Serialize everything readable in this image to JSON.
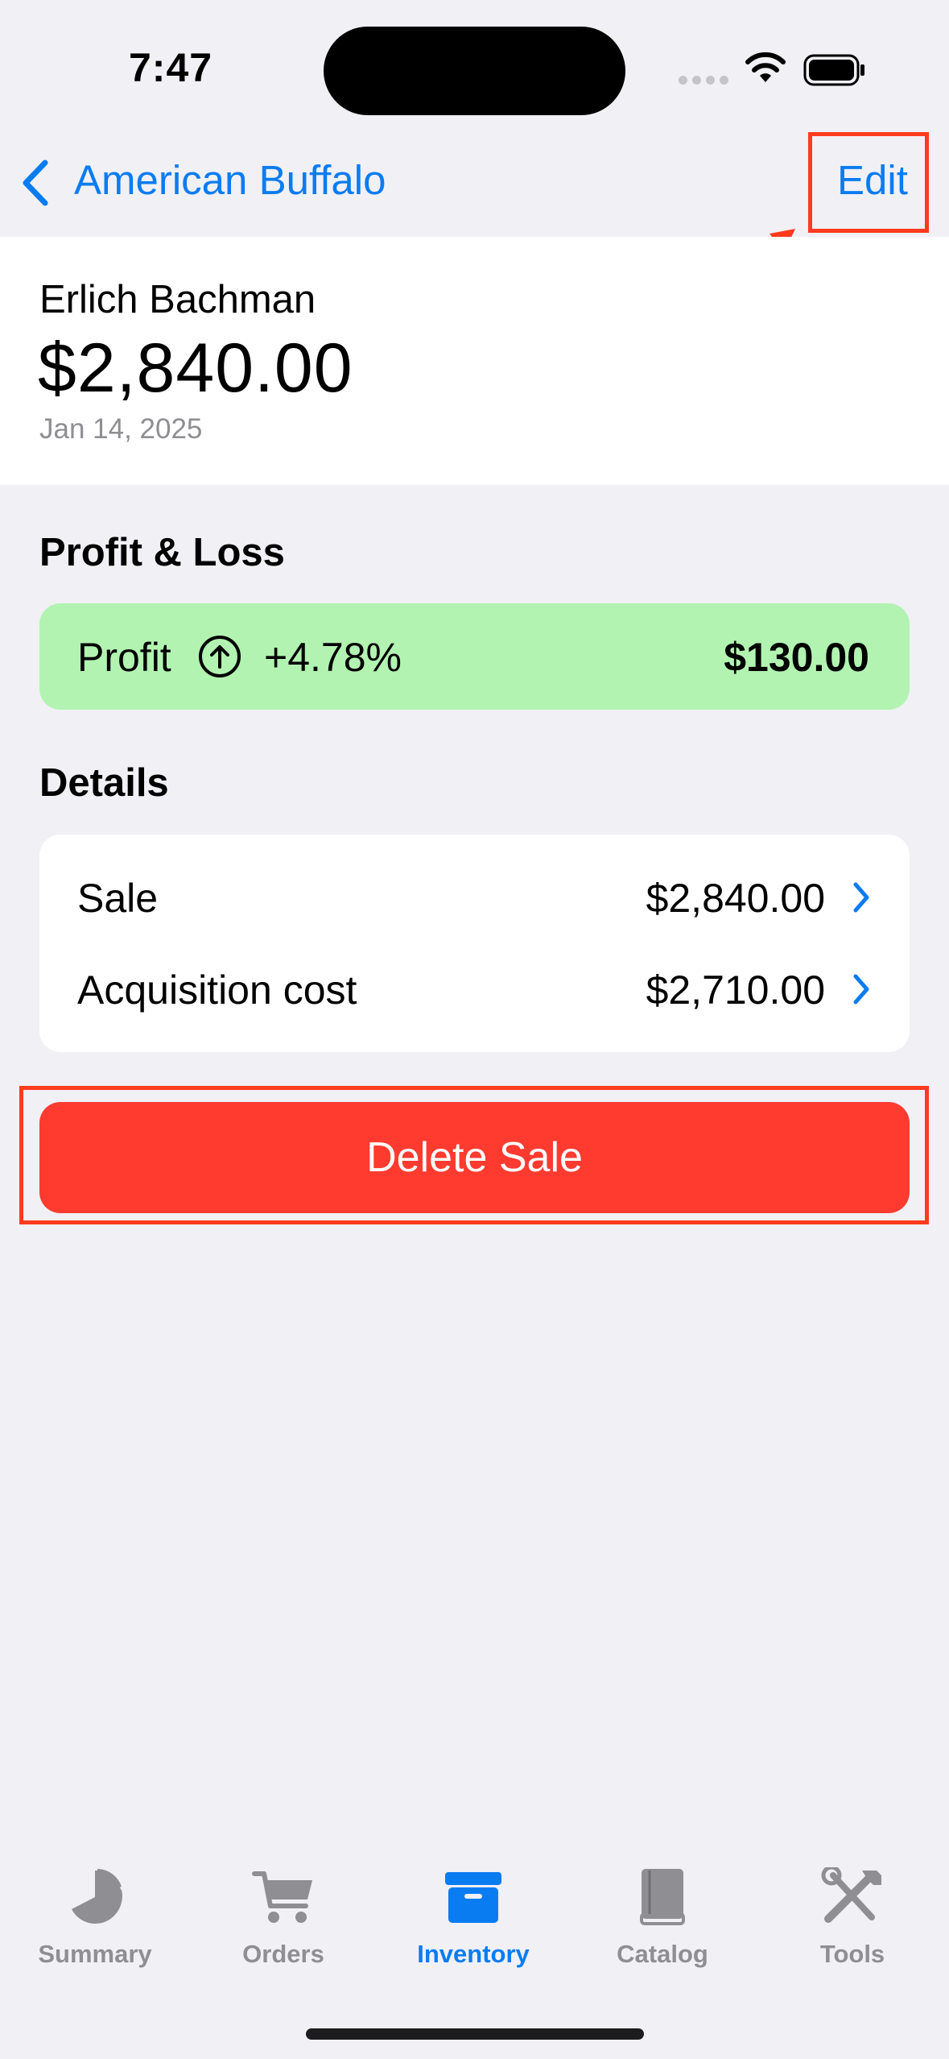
{
  "status_bar": {
    "time": "7:47"
  },
  "nav": {
    "back_label": "American Buffalo",
    "edit_label": "Edit"
  },
  "header": {
    "customer_name": "Erlich Bachman",
    "amount": "$2,840.00",
    "date": "Jan 14, 2025"
  },
  "profit_loss": {
    "title": "Profit & Loss",
    "label": "Profit",
    "percent": "+4.78%",
    "value": "$130.00",
    "accent": "#b2f3b1"
  },
  "details": {
    "title": "Details",
    "rows": [
      {
        "label": "Sale",
        "value": "$2,840.00"
      },
      {
        "label": "Acquisition cost",
        "value": "$2,710.00"
      }
    ]
  },
  "delete_label": "Delete Sale",
  "tabs": [
    {
      "label": "Summary",
      "icon": "pie-chart-icon"
    },
    {
      "label": "Orders",
      "icon": "cart-icon"
    },
    {
      "label": "Inventory",
      "icon": "archive-box-icon",
      "active": true
    },
    {
      "label": "Catalog",
      "icon": "book-icon"
    },
    {
      "label": "Tools",
      "icon": "tools-icon"
    }
  ],
  "colors": {
    "accent": "#0a7cf2",
    "destructive": "#ff3b30",
    "highlight": "#ff3b1f"
  }
}
